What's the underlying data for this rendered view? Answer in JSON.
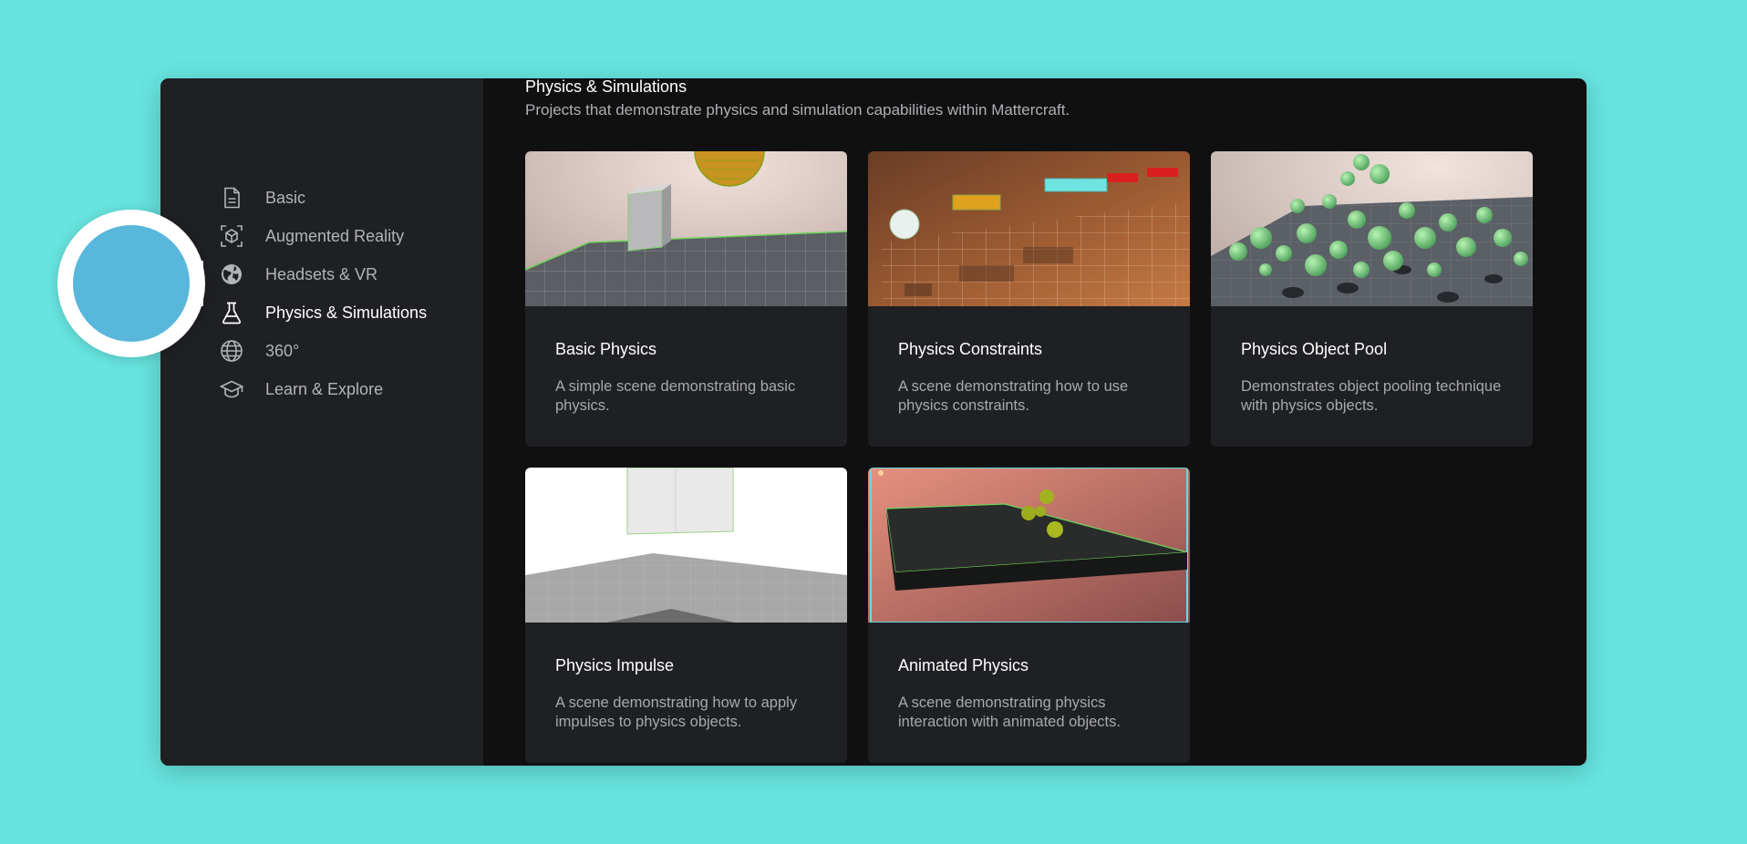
{
  "sidebar": {
    "items": [
      {
        "label": "Basic",
        "icon": "document-icon",
        "active": false
      },
      {
        "label": "Augmented Reality",
        "icon": "ar-cube-icon",
        "active": false
      },
      {
        "label": "Headsets & VR",
        "icon": "globe-icon",
        "active": false
      },
      {
        "label": "Physics & Simulations",
        "icon": "flask-icon",
        "active": true
      },
      {
        "label": "360°",
        "icon": "globe-grid-icon",
        "active": false
      },
      {
        "label": "Learn & Explore",
        "icon": "graduation-cap-icon",
        "active": false
      }
    ]
  },
  "main": {
    "section_title": "Physics & Simulations",
    "section_description": "Projects that demonstrate physics and simulation capabilities within Mattercraft.",
    "cards": [
      {
        "title": "Basic Physics",
        "description": "A simple scene demonstrating basic physics."
      },
      {
        "title": "Physics Constraints",
        "description": "A scene demonstrating how to use physics constraints."
      },
      {
        "title": "Physics Object Pool",
        "description": "Demonstrates object pooling technique with physics objects."
      },
      {
        "title": "Physics Impulse",
        "description": "A scene demonstrating how to apply impulses to physics objects."
      },
      {
        "title": "Animated Physics",
        "description": "A scene demonstrating physics interaction with animated objects."
      }
    ]
  },
  "colors": {
    "background": "#67e4df",
    "window": "#101011",
    "sidebar": "#1f2023",
    "card": "#1f2023",
    "cursor": "#53b5da",
    "text_primary": "#ffffff",
    "text_secondary": "#a7a9ad"
  }
}
